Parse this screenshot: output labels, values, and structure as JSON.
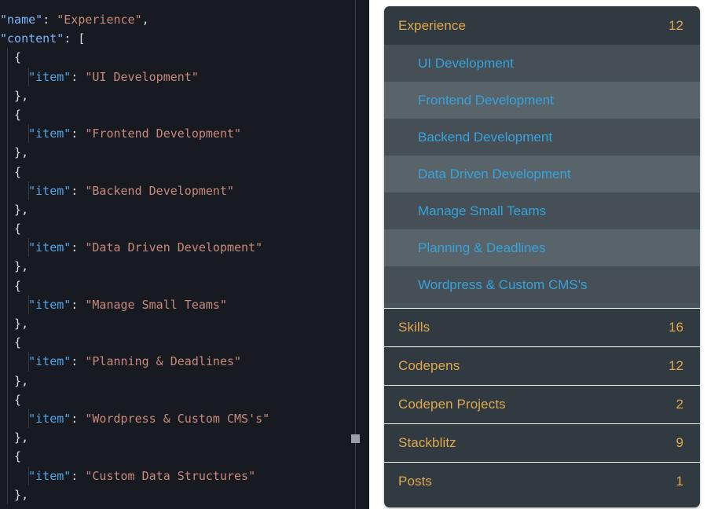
{
  "code_panel": {
    "language": "json",
    "lines": [
      {
        "indent": 0,
        "parts": [
          {
            "t": "\"name\"",
            "c": "key"
          },
          {
            "t": ": ",
            "c": "punct"
          },
          {
            "t": "\"Experience\"",
            "c": "str"
          },
          {
            "t": ",",
            "c": "punct"
          }
        ]
      },
      {
        "indent": 0,
        "parts": [
          {
            "t": "\"content\"",
            "c": "key"
          },
          {
            "t": ": ",
            "c": "punct"
          },
          {
            "t": "[",
            "c": "brace"
          }
        ]
      },
      {
        "indent": 1,
        "parts": [
          {
            "t": "{",
            "c": "brace"
          }
        ]
      },
      {
        "indent": 2,
        "parts": [
          {
            "t": "\"item\"",
            "c": "key-deep"
          },
          {
            "t": ": ",
            "c": "punct"
          },
          {
            "t": "\"UI Development\"",
            "c": "str"
          }
        ]
      },
      {
        "indent": 1,
        "parts": [
          {
            "t": "},",
            "c": "brace"
          }
        ]
      },
      {
        "indent": 1,
        "parts": [
          {
            "t": "{",
            "c": "brace"
          }
        ]
      },
      {
        "indent": 2,
        "parts": [
          {
            "t": "\"item\"",
            "c": "key-deep"
          },
          {
            "t": ": ",
            "c": "punct"
          },
          {
            "t": "\"Frontend Development\"",
            "c": "str"
          }
        ]
      },
      {
        "indent": 1,
        "parts": [
          {
            "t": "},",
            "c": "brace"
          }
        ]
      },
      {
        "indent": 1,
        "parts": [
          {
            "t": "{",
            "c": "brace"
          }
        ]
      },
      {
        "indent": 2,
        "parts": [
          {
            "t": "\"item\"",
            "c": "key-deep"
          },
          {
            "t": ": ",
            "c": "punct"
          },
          {
            "t": "\"Backend Development\"",
            "c": "str"
          }
        ]
      },
      {
        "indent": 1,
        "parts": [
          {
            "t": "},",
            "c": "brace"
          }
        ]
      },
      {
        "indent": 1,
        "parts": [
          {
            "t": "{",
            "c": "brace"
          }
        ]
      },
      {
        "indent": 2,
        "parts": [
          {
            "t": "\"item\"",
            "c": "key-deep"
          },
          {
            "t": ": ",
            "c": "punct"
          },
          {
            "t": "\"Data Driven Development\"",
            "c": "str"
          }
        ]
      },
      {
        "indent": 1,
        "parts": [
          {
            "t": "},",
            "c": "brace"
          }
        ]
      },
      {
        "indent": 1,
        "parts": [
          {
            "t": "{",
            "c": "brace"
          }
        ]
      },
      {
        "indent": 2,
        "parts": [
          {
            "t": "\"item\"",
            "c": "key-deep"
          },
          {
            "t": ": ",
            "c": "punct"
          },
          {
            "t": "\"Manage Small Teams\"",
            "c": "str"
          }
        ]
      },
      {
        "indent": 1,
        "parts": [
          {
            "t": "},",
            "c": "brace"
          }
        ]
      },
      {
        "indent": 1,
        "parts": [
          {
            "t": "{",
            "c": "brace"
          }
        ]
      },
      {
        "indent": 2,
        "parts": [
          {
            "t": "\"item\"",
            "c": "key-deep"
          },
          {
            "t": ": ",
            "c": "punct"
          },
          {
            "t": "\"Planning & Deadlines\"",
            "c": "str"
          }
        ]
      },
      {
        "indent": 1,
        "parts": [
          {
            "t": "},",
            "c": "brace"
          }
        ]
      },
      {
        "indent": 1,
        "parts": [
          {
            "t": "{",
            "c": "brace"
          }
        ]
      },
      {
        "indent": 2,
        "parts": [
          {
            "t": "\"item\"",
            "c": "key-deep"
          },
          {
            "t": ": ",
            "c": "punct"
          },
          {
            "t": "\"Wordpress & Custom CMS's\"",
            "c": "str"
          }
        ]
      },
      {
        "indent": 1,
        "parts": [
          {
            "t": "},",
            "c": "brace"
          }
        ]
      },
      {
        "indent": 1,
        "parts": [
          {
            "t": "{",
            "c": "brace"
          }
        ]
      },
      {
        "indent": 2,
        "parts": [
          {
            "t": "\"item\"",
            "c": "key-deep"
          },
          {
            "t": ": ",
            "c": "punct"
          },
          {
            "t": "\"Custom Data Structures\"",
            "c": "str"
          }
        ]
      },
      {
        "indent": 1,
        "parts": [
          {
            "t": "},",
            "c": "brace"
          }
        ]
      }
    ],
    "scrollbar": {
      "visible": true
    }
  },
  "accordion": {
    "groups": [
      {
        "label": "Experience",
        "count": "12",
        "expanded": true,
        "items": [
          {
            "label": "UI Development"
          },
          {
            "label": "Frontend Development"
          },
          {
            "label": "Backend Development"
          },
          {
            "label": "Data Driven Development"
          },
          {
            "label": "Manage Small Teams"
          },
          {
            "label": "Planning & Deadlines"
          },
          {
            "label": "Wordpress & Custom CMS's"
          }
        ]
      },
      {
        "label": "Skills",
        "count": "16",
        "expanded": false,
        "items": []
      },
      {
        "label": "Codepens",
        "count": "12",
        "expanded": false,
        "items": []
      },
      {
        "label": "Codepen Projects",
        "count": "2",
        "expanded": false,
        "items": []
      },
      {
        "label": "Stackblitz",
        "count": "9",
        "expanded": false,
        "items": []
      },
      {
        "label": "Posts",
        "count": "1",
        "expanded": false,
        "items": []
      }
    ]
  },
  "colors": {
    "code_bg": "#171a21",
    "code_key": "#79b8ff",
    "code_key_deep": "#4fa6e8",
    "code_string": "#c9897b",
    "code_punct": "#d7dce3",
    "page_bg": "#ffffff",
    "card_header_bg": "#313a41",
    "card_header_text": "#e0a84c",
    "sub_item_text": "#36a3dd",
    "sub_row_dark": "#454f55",
    "sub_row_light": "#59646a",
    "separator": "#ffffff"
  }
}
